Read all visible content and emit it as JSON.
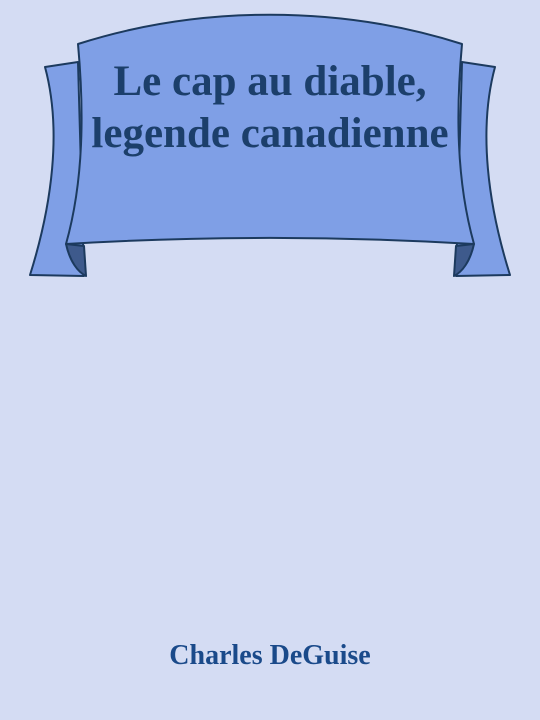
{
  "book": {
    "title": "Le cap au diable, legende canadienne",
    "author": "Charles DeGuise"
  },
  "colors": {
    "background": "#d4dcf3",
    "banner_fill": "#7f9fe6",
    "banner_shadow": "#5e7fc6",
    "banner_outline": "#1c3a5e",
    "title_text": "#1c3f6b",
    "author_text": "#1a4a8a"
  },
  "icons": {
    "banner": "ribbon-banner-icon"
  }
}
